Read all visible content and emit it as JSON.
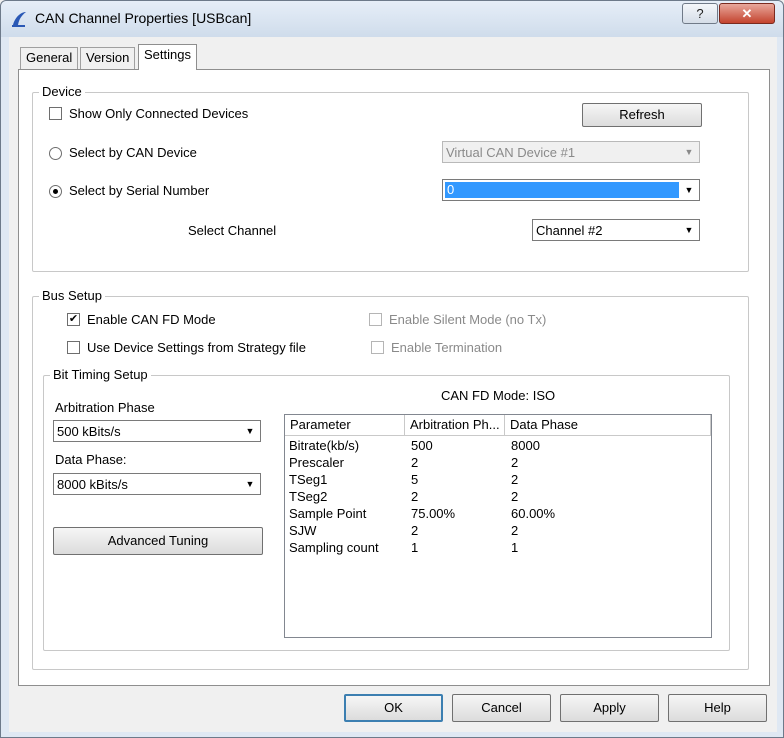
{
  "window": {
    "title": "CAN Channel Properties [USBcan]",
    "help_glyph": "?",
    "close_glyph": "✕"
  },
  "tabs": [
    {
      "label": "General"
    },
    {
      "label": "Version"
    },
    {
      "label": "Settings",
      "active": true
    }
  ],
  "device": {
    "legend": "Device",
    "show_only_connected": {
      "label": "Show Only Connected Devices",
      "checked": false
    },
    "refresh_label": "Refresh",
    "select_by_can_device": {
      "label": "Select by CAN Device",
      "selected": false,
      "value": "Virtual CAN Device #1"
    },
    "select_by_serial": {
      "label": "Select by Serial Number",
      "selected": true,
      "value": "0"
    },
    "select_channel": {
      "label": "Select Channel",
      "value": "Channel #2"
    }
  },
  "bus_setup": {
    "legend": "Bus Setup",
    "enable_can_fd": {
      "label": "Enable CAN FD Mode",
      "checked": true
    },
    "use_device_settings": {
      "label": "Use Device Settings from Strategy file",
      "checked": false
    },
    "enable_silent": {
      "label": "Enable Silent Mode (no Tx)",
      "checked": false,
      "disabled": true
    },
    "enable_termination": {
      "label": "Enable Termination",
      "checked": false,
      "disabled": true
    }
  },
  "bit_timing": {
    "legend": "Bit Timing Setup",
    "arbitration_label": "Arbitration Phase",
    "arbitration_value": "500 kBits/s",
    "data_phase_label": "Data Phase:",
    "data_phase_value": "8000 kBits/s",
    "advanced_tuning_label": "Advanced Tuning",
    "can_fd_mode": "CAN FD Mode: ISO",
    "table": {
      "columns": [
        "Parameter",
        "Arbitration Ph...",
        "Data Phase"
      ],
      "rows": [
        [
          "Bitrate(kb/s)",
          "500",
          "8000"
        ],
        [
          "Prescaler",
          "2",
          "2"
        ],
        [
          "TSeg1",
          "5",
          "2"
        ],
        [
          "TSeg2",
          "2",
          "2"
        ],
        [
          "Sample Point",
          "75.00%",
          "60.00%"
        ],
        [
          "SJW",
          "2",
          "2"
        ],
        [
          "Sampling count",
          "1",
          "1"
        ]
      ]
    }
  },
  "footer": {
    "ok": "OK",
    "cancel": "Cancel",
    "apply": "Apply",
    "help": "Help"
  },
  "colors": {
    "selection": "#3399ff",
    "title_gradient_top": "#e6eef8",
    "close_button": "#c4432e"
  }
}
